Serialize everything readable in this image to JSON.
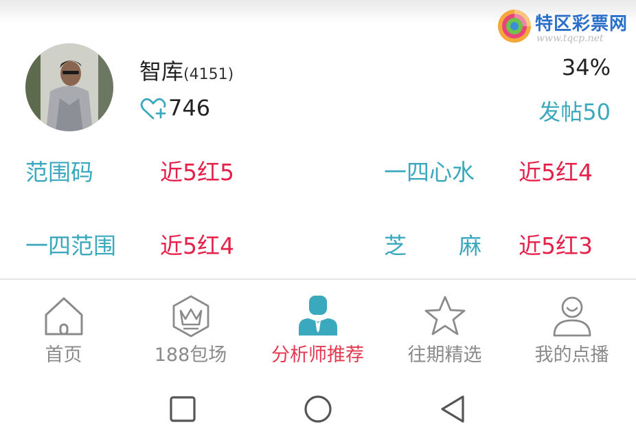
{
  "watermark": {
    "title": "特区彩票网",
    "url": "www.tqcp.net"
  },
  "profile": {
    "name": "智库",
    "count": "(4151)",
    "rate": "34%",
    "likes": "746",
    "posts": "发帖50"
  },
  "stats": [
    {
      "label": "范围码",
      "value": "近5红5"
    },
    {
      "label": "一四心水",
      "value": "近5红4"
    },
    {
      "label": "一四范围",
      "value": "近5红4"
    },
    {
      "label": "芝麻",
      "value": "近5红3"
    }
  ],
  "tabs": [
    {
      "label": "首页",
      "icon": "home-icon"
    },
    {
      "label": "188包场",
      "icon": "crown-icon"
    },
    {
      "label": "分析师推荐",
      "icon": "analyst-icon",
      "active": true
    },
    {
      "label": "往期精选",
      "icon": "star-icon"
    },
    {
      "label": "我的点播",
      "icon": "user-icon"
    }
  ],
  "colors": {
    "accent_teal": "#3aa8bd",
    "accent_red": "#e5214a",
    "tab_active": "#e4384e",
    "tab_inactive": "#8a8a8a"
  }
}
